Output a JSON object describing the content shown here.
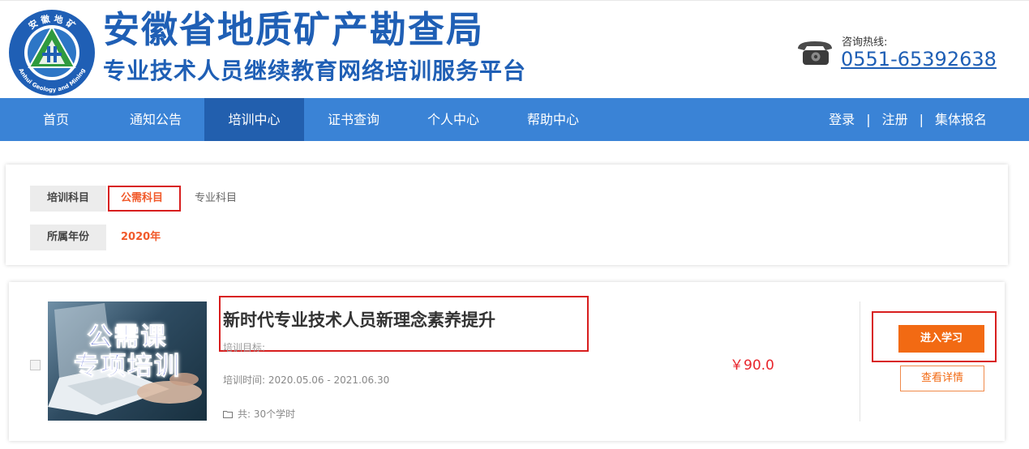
{
  "header": {
    "title": "安徽省地质矿产勘查局",
    "subtitle": "专业技术人员继续教育网络培训服务平台",
    "logo_badge_top": "安 徽 地 矿",
    "logo_badge_bottom": "Anhui Geology and Mining",
    "hotline_label": "咨询热线:",
    "hotline_number": "0551-65392638",
    "brand_color": "#1f5fb5"
  },
  "nav": {
    "items": [
      {
        "label": "首页"
      },
      {
        "label": "通知公告"
      },
      {
        "label": "培训中心"
      },
      {
        "label": "证书查询"
      },
      {
        "label": "个人中心"
      },
      {
        "label": "帮助中心"
      }
    ],
    "active_item": "培训中心",
    "login": "登录",
    "register": "注册",
    "group_signup": "集体报名",
    "separator": "|",
    "bar_color": "#3a83d6",
    "active_color": "#225fae"
  },
  "filters": {
    "subject_label": "培训科目",
    "subject_options": [
      "公需科目",
      "专业科目"
    ],
    "subject_selected": "公需科目",
    "year_label": "所属年份",
    "year_selected": "2020年",
    "accent_color": "#f15a2b"
  },
  "course": {
    "thumb_line1": "公需课",
    "thumb_line2": "专项培训",
    "title": "新时代专业技术人员新理念素养提升",
    "goal_label": "培训目标:",
    "time_text": "培训时间: 2020.05.06 - 2021.06.30",
    "hours_text": "共: 30个学时",
    "price": "￥90.0",
    "enter_label": "进入学习",
    "detail_label": "查看详情",
    "button_color": "#f26a13",
    "price_color": "#e8242b"
  },
  "annotations": {
    "highlight_color": "#d81e1e"
  }
}
